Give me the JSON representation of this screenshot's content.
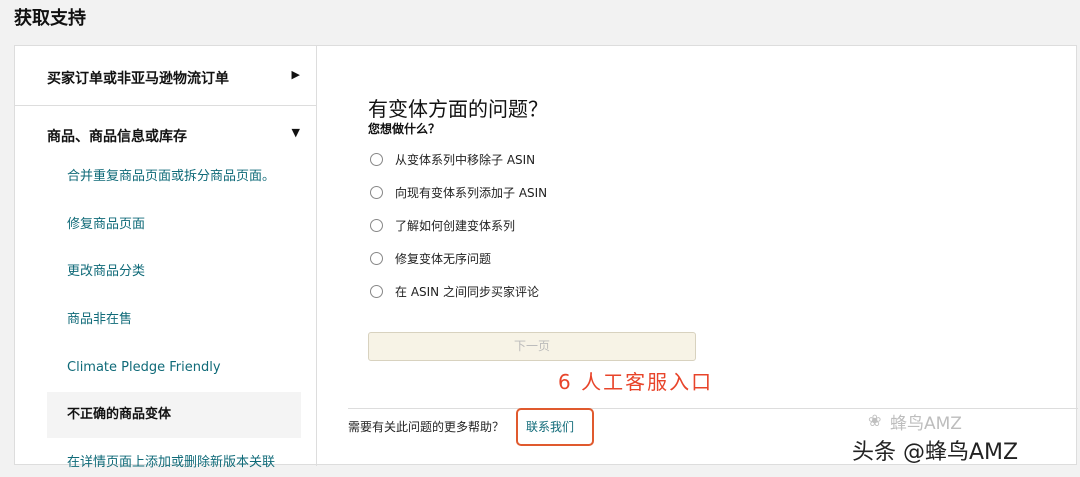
{
  "page": {
    "title": "获取支持"
  },
  "sidebar": {
    "section1": {
      "label": "买家订单或非亚马逊物流订单",
      "arrow": "▶"
    },
    "section2": {
      "label": "商品、商品信息或库存",
      "arrow": "▼"
    },
    "items": [
      {
        "label": "合并重复商品页面或拆分商品页面。"
      },
      {
        "label": "修复商品页面"
      },
      {
        "label": "更改商品分类"
      },
      {
        "label": "商品非在售"
      },
      {
        "label": "Climate Pledge Friendly"
      },
      {
        "label": "不正确的商品变体"
      },
      {
        "label": "在详情页面上添加或删除新版本关联"
      }
    ]
  },
  "main": {
    "question": "有变体方面的问题？",
    "subtitle": "您想做什么？",
    "options": [
      {
        "label": "从变体系列中移除子 ASIN"
      },
      {
        "label": "向现有变体系列添加子 ASIN"
      },
      {
        "label": "了解如何创建变体系列"
      },
      {
        "label": "修复变体无序问题"
      },
      {
        "label": "在 ASIN 之间同步买家评论"
      }
    ],
    "next_label": "下一页",
    "help_text": "需要有关此问题的更多帮助？",
    "contact_label": "联系我们"
  },
  "annotation": {
    "text": "6 人工客服入口",
    "color": "#e8442a"
  },
  "watermark": {
    "light": "蜂鸟AMZ",
    "main": "头条 @蜂鸟AMZ"
  }
}
